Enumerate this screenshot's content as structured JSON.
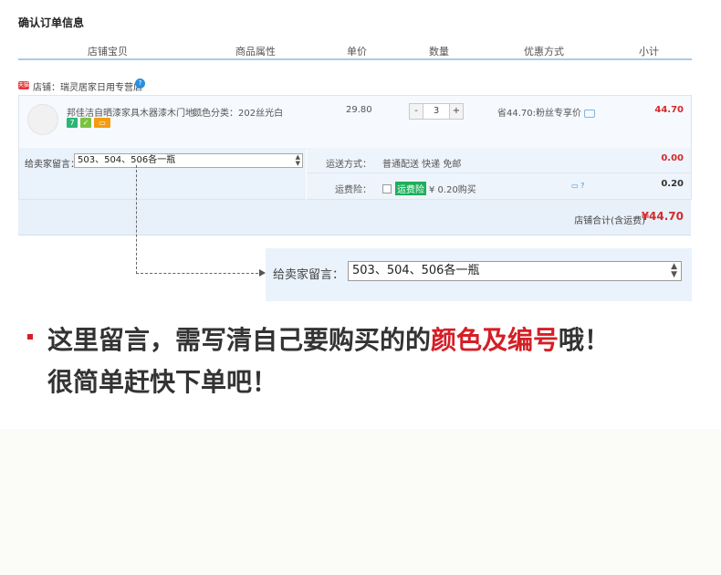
{
  "page_title": "确认订单信息",
  "columns": [
    "店铺宝贝",
    "商品属性",
    "单价",
    "数量",
    "优惠方式",
    "小计"
  ],
  "shop": {
    "badge": "天猫",
    "label": "店铺：瑞灵居家日用专营店",
    "info_icon": "?"
  },
  "item": {
    "title": "邦佳洁自晒漆家具木器漆木门地...",
    "sku": "颜色分类：202丝光白",
    "tags": [
      "7",
      "✓",
      "▭"
    ],
    "price": "29.80",
    "qty_minus": "-",
    "qty_value": "3",
    "qty_plus": "+",
    "discount": "省44.70:粉丝专享价",
    "subtotal": "44.70"
  },
  "note": {
    "label": "给卖家留言：",
    "value": "503、504、506各一瓶"
  },
  "shipping": {
    "label": "运送方式：",
    "value": "普通配送 快递 免邮",
    "amount": "0.00"
  },
  "insurance": {
    "label": "运费险：",
    "tag": "运费险",
    "value": "¥ 0.20购买",
    "amount": "0.20"
  },
  "total": {
    "label": "店铺合计(含运费)",
    "amount": "¥44.70"
  },
  "zoom": {
    "label": "给卖家留言：",
    "value": "503、504、506各一瓶"
  },
  "caption": {
    "line1_prefix": "这里留言，需写清自己要购买的的",
    "line1_highlight": "颜色及编号",
    "line1_suffix": "哦！",
    "line2": "很简单赶快下单吧！"
  },
  "colors": {
    "accent_red": "#d42b2b",
    "header_line": "#a9cbe8",
    "panel_blue": "#eaf2fb"
  }
}
